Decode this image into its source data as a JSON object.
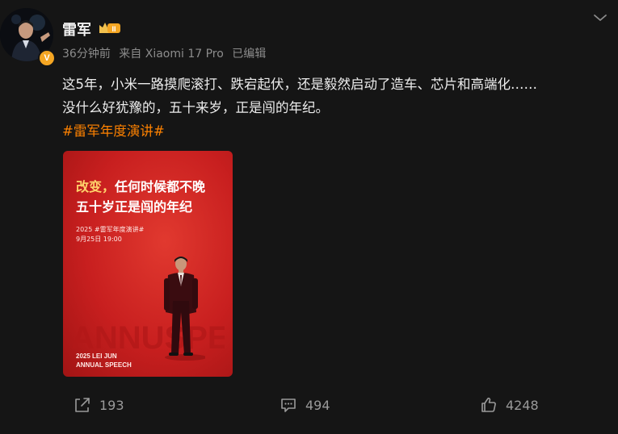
{
  "colors": {
    "background": "#151515",
    "text": "#ececec",
    "meta": "#8c8c8c",
    "hashtag": "#ff8200",
    "poster_red": "#c81f1f",
    "badge_gold": "#f5a623"
  },
  "author": {
    "name": "雷军",
    "level_badge": "II",
    "verified_mark": "V",
    "avatar_icon": "avatar-photo"
  },
  "meta": {
    "time": "36分钟前",
    "source": "来自 Xiaomi 17 Pro",
    "edited": "已编辑"
  },
  "post": {
    "line1": "这5年，小米一路摸爬滚打、跌宕起伏，还是毅然启动了造车、芯片和高端化……",
    "line2": "没什么好犹豫的，五十来岁，正是闯的年纪。",
    "hashtag": "#雷军年度演讲#"
  },
  "poster": {
    "headline_accent": "改变，",
    "headline_rest": "任何时候都不晚",
    "headline_line2": "五十岁正是闯的年纪",
    "event_name": "2025 #雷军年度演讲#",
    "event_time": "9月25日 19:00",
    "footer_line1": "2025 LEI JUN",
    "footer_line2": "ANNUAL SPEECH"
  },
  "actions": {
    "repost_count": "193",
    "comment_count": "494",
    "like_count": "4248",
    "repost_icon": "share-icon",
    "comment_icon": "comment-icon",
    "like_icon": "thumbs-up-icon"
  }
}
